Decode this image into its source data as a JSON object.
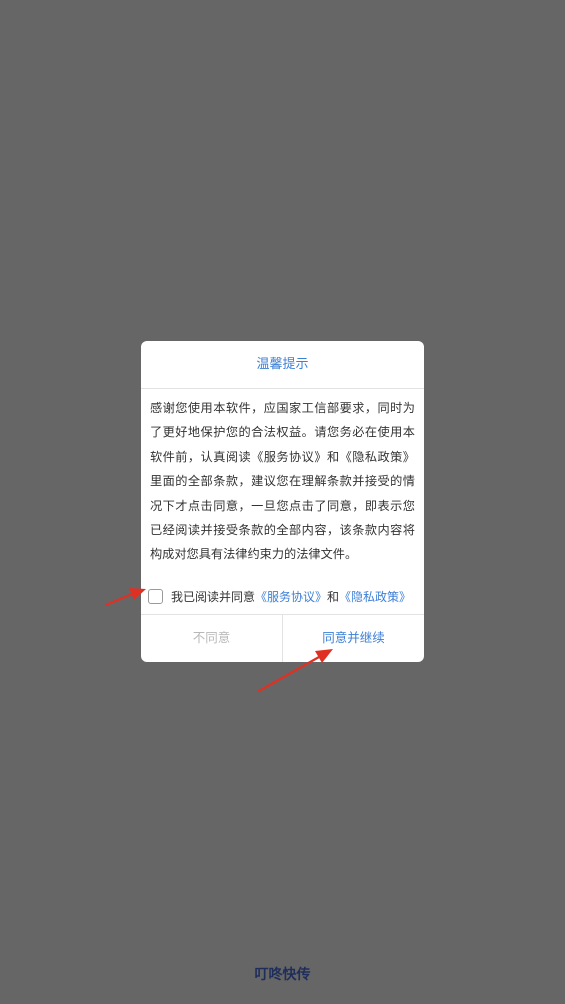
{
  "dialog": {
    "title": "温馨提示",
    "body": "感谢您使用本软件，应国家工信部要求，同时为了更好地保护您的合法权益。请您务必在使用本软件前，认真阅读《服务协议》和《隐私政策》里面的全部条款，建议您在理解条款并接受的情况下才点击同意，一旦您点击了同意，即表示您已经阅读并接受条款的全部内容，该条款内容将构成对您具有法律约束力的法律文件。",
    "agree_prefix": "我已阅读并同意",
    "service_link": "《服务协议》",
    "and_text": "和",
    "privacy_link": "《隐私政策》",
    "checkbox_checked": false,
    "disagree_label": "不同意",
    "agree_label": "同意并继续"
  },
  "footer": {
    "brand": "叮咚快传"
  },
  "colors": {
    "overlay": "#666666",
    "accent": "#3d7fd6",
    "annotation_arrow": "#e03024"
  }
}
